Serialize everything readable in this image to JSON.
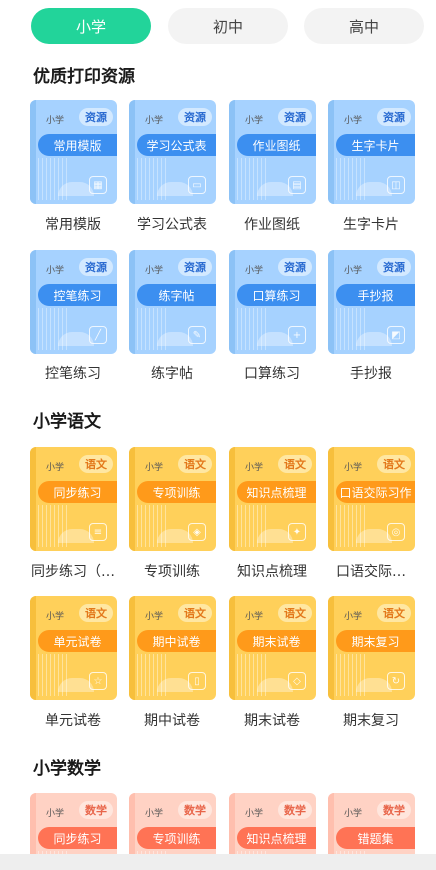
{
  "tabs": [
    {
      "label": "小学",
      "active": true
    },
    {
      "label": "初中",
      "active": false
    },
    {
      "label": "高中",
      "active": false
    }
  ],
  "sections": [
    {
      "title": "优质打印资源"
    },
    {
      "title": "小学语文"
    },
    {
      "title": "小学数学"
    }
  ],
  "cards": [
    {
      "grade": "小学",
      "subject": "资源",
      "ribbon": "常用模版",
      "label": "常用模版",
      "icon": "grid-icon"
    },
    {
      "grade": "小学",
      "subject": "资源",
      "ribbon": "学习公式表",
      "label": "学习公式表",
      "icon": "chart-icon"
    },
    {
      "grade": "小学",
      "subject": "资源",
      "ribbon": "作业图纸",
      "label": "作业图纸",
      "icon": "paper-icon"
    },
    {
      "grade": "小学",
      "subject": "资源",
      "ribbon": "生字卡片",
      "label": "生字卡片",
      "icon": "card-icon"
    },
    {
      "grade": "小学",
      "subject": "资源",
      "ribbon": "控笔练习",
      "label": "控笔练习",
      "icon": "pen-icon"
    },
    {
      "grade": "小学",
      "subject": "资源",
      "ribbon": "练字帖",
      "label": "练字帖",
      "icon": "brush-icon"
    },
    {
      "grade": "小学",
      "subject": "资源",
      "ribbon": "口算练习",
      "label": "口算练习",
      "icon": "plus-icon"
    },
    {
      "grade": "小学",
      "subject": "资源",
      "ribbon": "手抄报",
      "label": "手抄报",
      "icon": "poster-icon"
    },
    {
      "grade": "小学",
      "subject": "语文",
      "ribbon": "同步练习",
      "label": "同步练习（…",
      "icon": "list-icon"
    },
    {
      "grade": "小学",
      "subject": "语文",
      "ribbon": "专项训练",
      "label": "专项训练",
      "icon": "layers-icon"
    },
    {
      "grade": "小学",
      "subject": "语文",
      "ribbon": "知识点梳理",
      "label": "知识点梳理",
      "icon": "bulb-icon"
    },
    {
      "grade": "小学",
      "subject": "语文",
      "ribbon": "口语交际习作",
      "label": "口语交际…",
      "icon": "speech-icon"
    },
    {
      "grade": "小学",
      "subject": "语文",
      "ribbon": "单元试卷",
      "label": "单元试卷",
      "icon": "star-icon"
    },
    {
      "grade": "小学",
      "subject": "语文",
      "ribbon": "期中试卷",
      "label": "期中试卷",
      "icon": "doc-icon"
    },
    {
      "grade": "小学",
      "subject": "语文",
      "ribbon": "期末试卷",
      "label": "期末试卷",
      "icon": "test-icon"
    },
    {
      "grade": "小学",
      "subject": "语文",
      "ribbon": "期末复习",
      "label": "期末复习",
      "icon": "review-icon"
    },
    {
      "grade": "小学",
      "subject": "数学",
      "ribbon": "同步练习",
      "label": "",
      "icon": "list-icon"
    },
    {
      "grade": "小学",
      "subject": "数学",
      "ribbon": "专项训练",
      "label": "",
      "icon": "layers-icon"
    },
    {
      "grade": "小学",
      "subject": "数学",
      "ribbon": "知识点梳理",
      "label": "",
      "icon": "bulb-icon"
    },
    {
      "grade": "小学",
      "subject": "数学",
      "ribbon": "错题集",
      "label": "",
      "icon": "book-icon"
    }
  ]
}
